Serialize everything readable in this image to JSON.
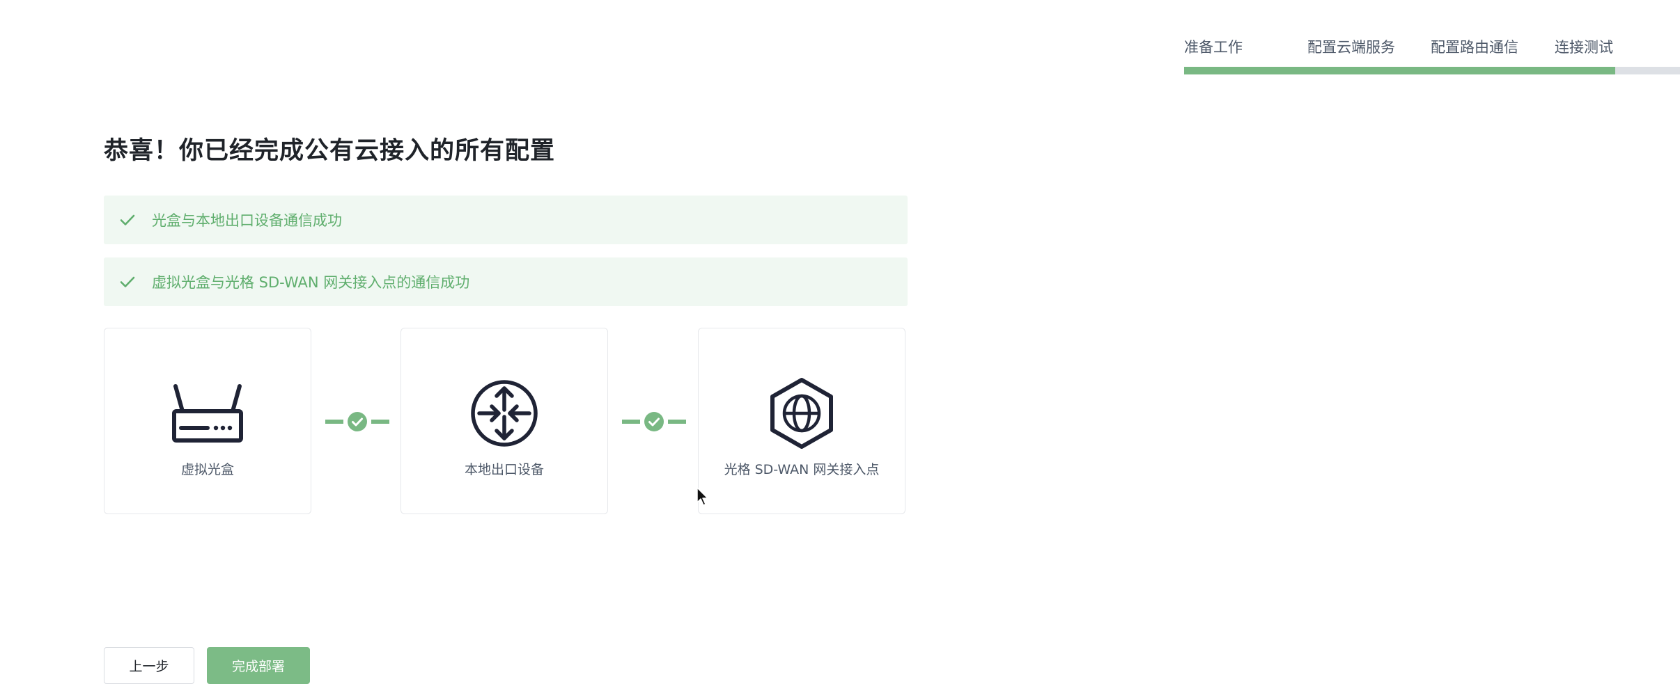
{
  "stepper": {
    "steps": [
      "准备工作",
      "配置云端服务",
      "配置路由通信",
      "连接测试"
    ],
    "progress_fraction": 0.87,
    "fill_color": "#79b883",
    "track_color": "#dde0e5"
  },
  "page_title": "恭喜！你已经完成公有云接入的所有配置",
  "alerts": [
    {
      "text": "光盒与本地出口设备通信成功",
      "icon": "check-icon"
    },
    {
      "text": "虚拟光盒与光格 SD-WAN 网关接入点的通信成功",
      "icon": "check-icon"
    }
  ],
  "devices": [
    {
      "label": "虚拟光盒",
      "icon": "router-icon"
    },
    {
      "label": "本地出口设备",
      "icon": "exit-device-icon"
    },
    {
      "label": "光格 SD-WAN 网关接入点",
      "icon": "globe-hexagon-icon"
    }
  ],
  "connectors": [
    {
      "status": "connected",
      "icon": "check-circle-icon"
    },
    {
      "status": "connected",
      "icon": "check-circle-icon"
    }
  ],
  "buttons": {
    "prev_label": "上一步",
    "finish_label": "完成部署"
  },
  "colors": {
    "success": "#5fae6d",
    "success_bg": "#f0f8f2",
    "primary_button": "#7cbb86",
    "icon_dark": "#1f2335"
  }
}
